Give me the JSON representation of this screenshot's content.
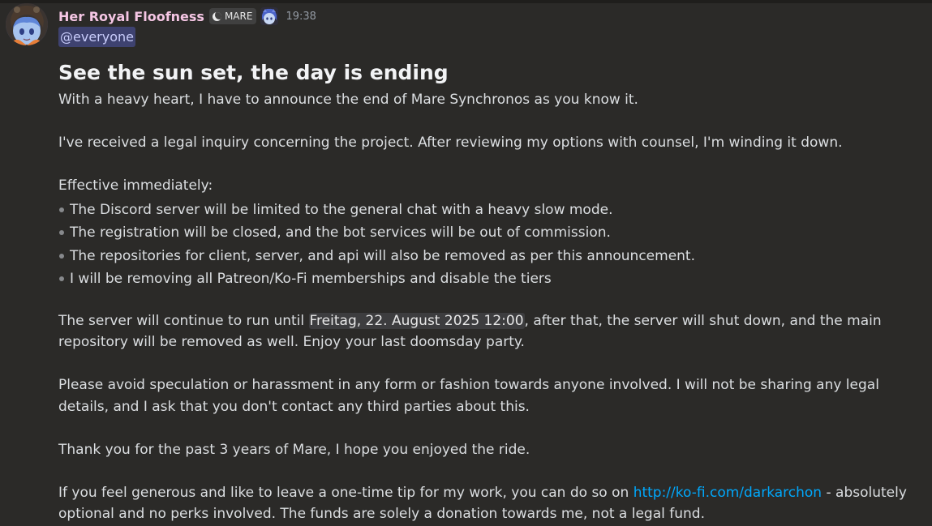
{
  "message": {
    "author": "Her Royal Floofness",
    "role_tag": "MARE",
    "timestamp": "19:38",
    "mention": "@everyone",
    "heading": "See the sun set, the day is ending",
    "intro": "With a heavy heart, I have to announce the end of Mare Synchronos as you know it.",
    "legal": "I've received a legal inquiry concerning the project. After reviewing my options with counsel, I'm winding it down.",
    "effective_label": "Effective immediately:",
    "bullets": [
      "The Discord server will be limited to the general chat with a heavy slow mode.",
      "The registration will be closed, and the bot services will be out of commission.",
      "The repositories for client, server, and api will also be removed as per this announcement.",
      "I will be removing all Patreon/Ko-Fi memberships and disable the tiers"
    ],
    "server_pre": "The server will continue to run until ",
    "server_date": "Freitag, 22. August 2025 12:00",
    "server_post": ", after that, the server will shut down, and the main repository will be removed as well. Enjoy your last doomsday party.",
    "avoid": "Please avoid speculation or harassment in any form or fashion towards anyone involved. I will not be sharing any legal details, and I ask that you don't contact any third parties about this.",
    "thanks": "Thank you for the past 3 years of Mare, I hope you enjoyed the ride.",
    "tip_pre": "If you feel generous and like to leave a one-time tip for my work, you can do so on ",
    "tip_link": "http://ko-fi.com/darkarchon",
    "tip_post": " - absolutely optional and no perks involved. The funds are solely a donation towards me, not a legal fund."
  },
  "icons": {
    "avatar": "avatar-anime-girl",
    "role": "moon-icon",
    "role_badge": "role-badge-icon"
  },
  "colors": {
    "background": "#2b2a28",
    "author": "#f5c6e4",
    "mention_bg": "#3e4270",
    "mention_text": "#c9cdfb",
    "link": "#00a8fc",
    "text": "#dbdee1",
    "timestamp": "#949ba4"
  }
}
